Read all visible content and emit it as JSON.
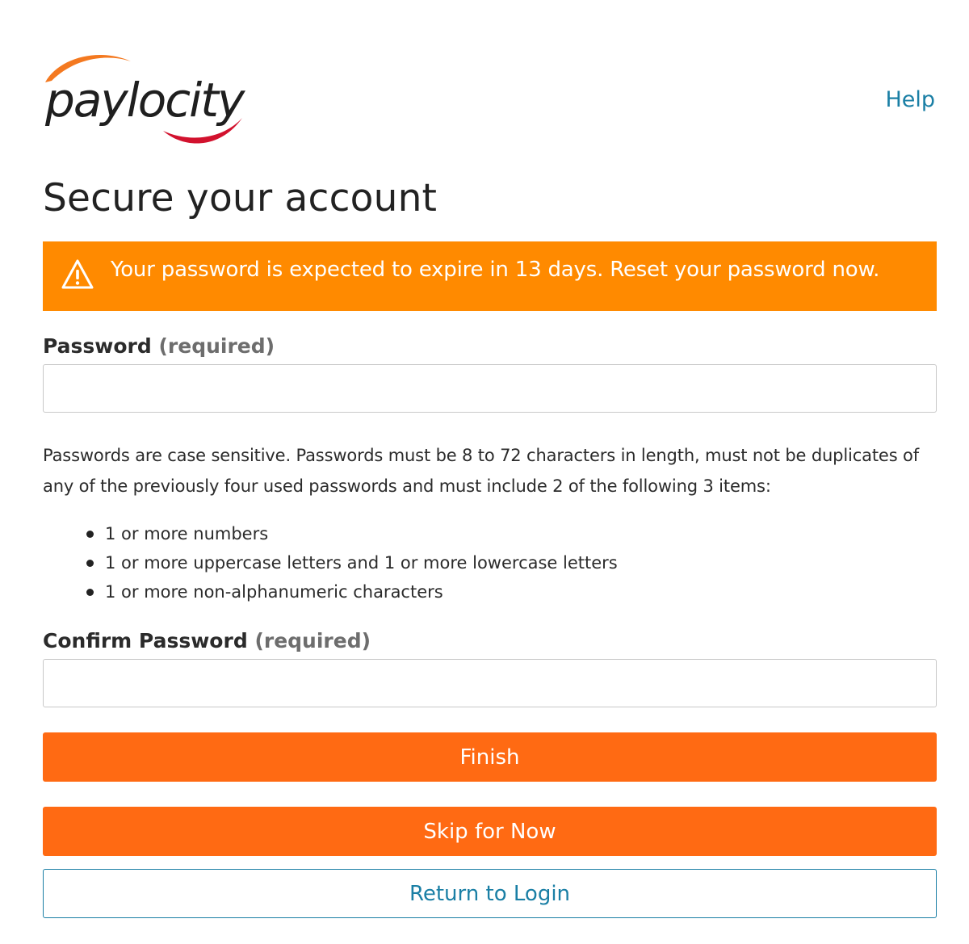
{
  "brand": {
    "logo_text": "paylocity",
    "colors": {
      "orange": "#ff6a13",
      "alert_orange": "#ff8a00",
      "link_blue": "#1a7fa5",
      "swoosh_red": "#d2122e"
    }
  },
  "header": {
    "help_label": "Help"
  },
  "page": {
    "title": "Secure your account"
  },
  "alert": {
    "icon": "warning-icon",
    "message": "Your password is expected to expire in 13 days. Reset your password now."
  },
  "password_field": {
    "label": "Password",
    "required_text": "(required)",
    "value": "",
    "placeholder": ""
  },
  "rules": {
    "description": "Passwords are case sensitive. Passwords must be 8 to 72 characters in length, must not be duplicates of any of the previously four used passwords and must include 2 of the following 3 items:",
    "items": [
      "1 or more numbers",
      "1 or more uppercase letters and 1 or more lowercase letters",
      "1 or more non-alphanumeric characters"
    ]
  },
  "confirm_field": {
    "label": "Confirm Password",
    "required_text": "(required)",
    "value": "",
    "placeholder": ""
  },
  "buttons": {
    "finish": "Finish",
    "skip": "Skip for Now",
    "return_login": "Return to Login"
  }
}
